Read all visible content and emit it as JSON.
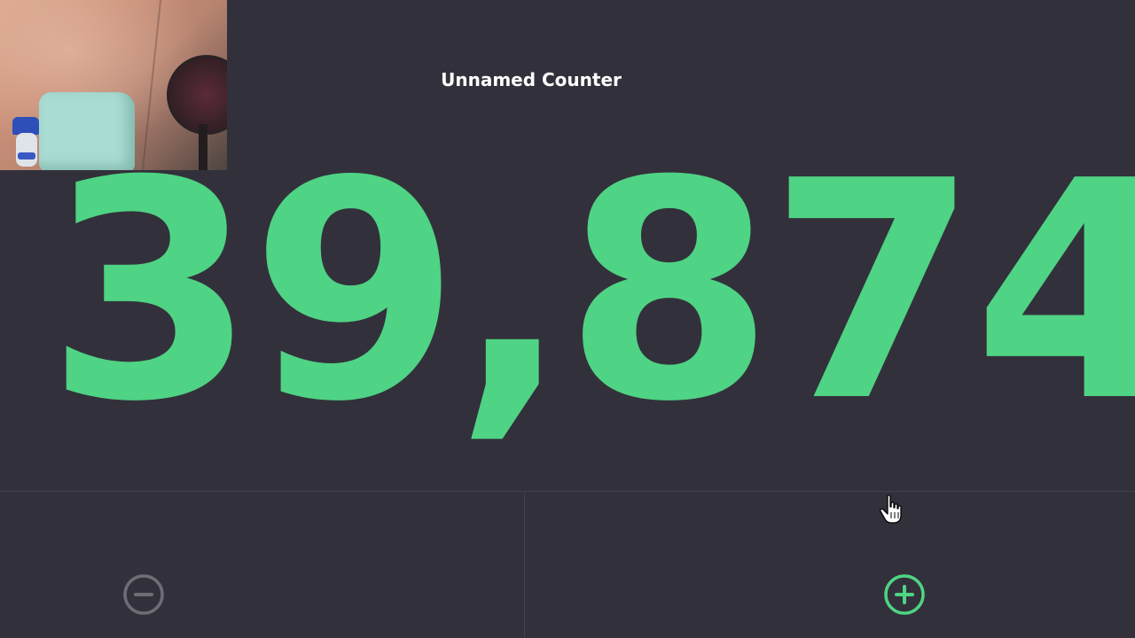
{
  "counter": {
    "title": "Unnamed Counter",
    "value": "39,874"
  },
  "controls": {
    "decrement_icon": "minus-circle-icon",
    "increment_icon": "plus-circle-icon"
  },
  "webcam": {
    "icon": "webcam-overlay"
  },
  "colors": {
    "background": "#32313b",
    "accent": "#4fd384",
    "muted": "#6e6d76",
    "title": "#ffffff"
  }
}
